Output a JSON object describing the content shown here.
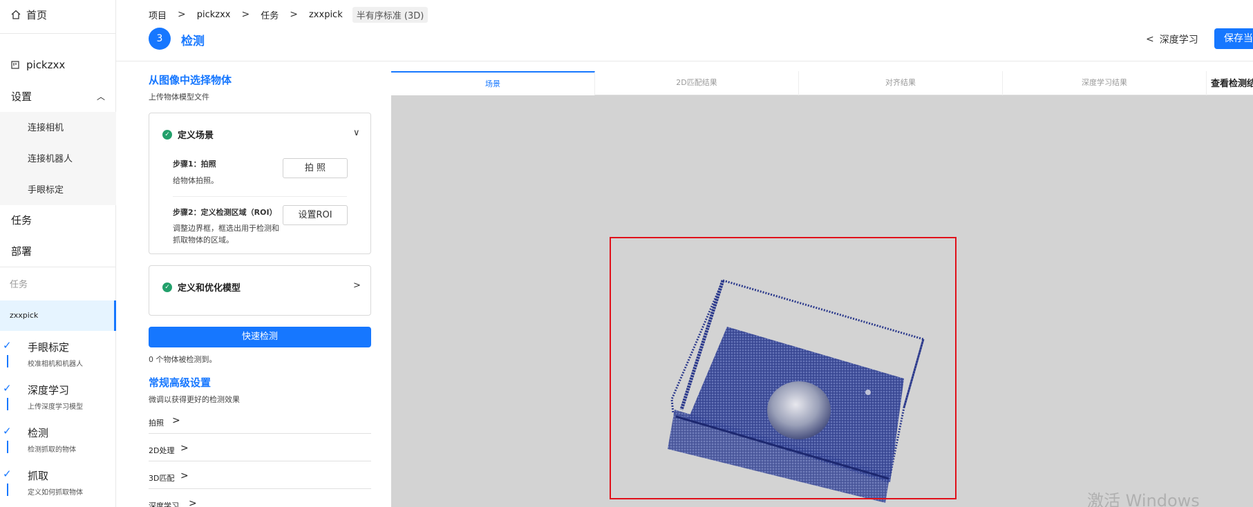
{
  "sidebar": {
    "home": "首页",
    "project": "pickzxx",
    "settings": "设置",
    "settings_items": [
      "连接相机",
      "连接机器人",
      "手眼标定"
    ],
    "tasks": "任务",
    "deploy": "部署",
    "task_caption": "任务",
    "active_task": "zxxpick",
    "steps": [
      {
        "title": "手眼标定",
        "desc": "校准相机和机器人"
      },
      {
        "title": "深度学习",
        "desc": "上传深度学习模型"
      },
      {
        "title": "检测",
        "desc": "检测抓取的物体"
      },
      {
        "title": "抓取",
        "desc": "定义如何抓取物体"
      }
    ]
  },
  "header": {
    "breadcrumb": [
      "项目",
      "pickzxx",
      "任务",
      "zxxpick"
    ],
    "tag": "半有序标准 (3D)",
    "step_number": "3",
    "title": "检测",
    "back_label": "深度学习",
    "save_label": "保存当"
  },
  "panel": {
    "select_title": "从图像中选择物体",
    "select_sub": "上传物体模型文件",
    "scene_card": {
      "title": "定义场景",
      "step1_title": "步骤1：拍照",
      "step1_desc": "给物体拍照。",
      "step1_btn": "拍 照",
      "step2_title": "步骤2：定义检测区域（ROI）",
      "step2_desc": "调整边界框，框选出用于检测和抓取物体的区域。",
      "step2_btn": "设置ROI"
    },
    "model_card": {
      "title": "定义和优化模型"
    },
    "quick_detect": "快速检测",
    "detect_count": "0 个物体被检测到。",
    "advanced_title": "常规高级设置",
    "advanced_sub": "微调以获得更好的检测效果",
    "advanced_items": [
      "拍照",
      "2D处理",
      "3D匹配",
      "深度学习"
    ]
  },
  "tabs": [
    "场景",
    "2D匹配结果",
    "对齐结果",
    "深度学习结果",
    "查看检测结"
  ],
  "watermark": "激活 Windows",
  "colors": {
    "accent": "#1677ff",
    "roi": "#e0101a",
    "success": "#22a06b",
    "pointcloud": "#2c3a8c"
  }
}
